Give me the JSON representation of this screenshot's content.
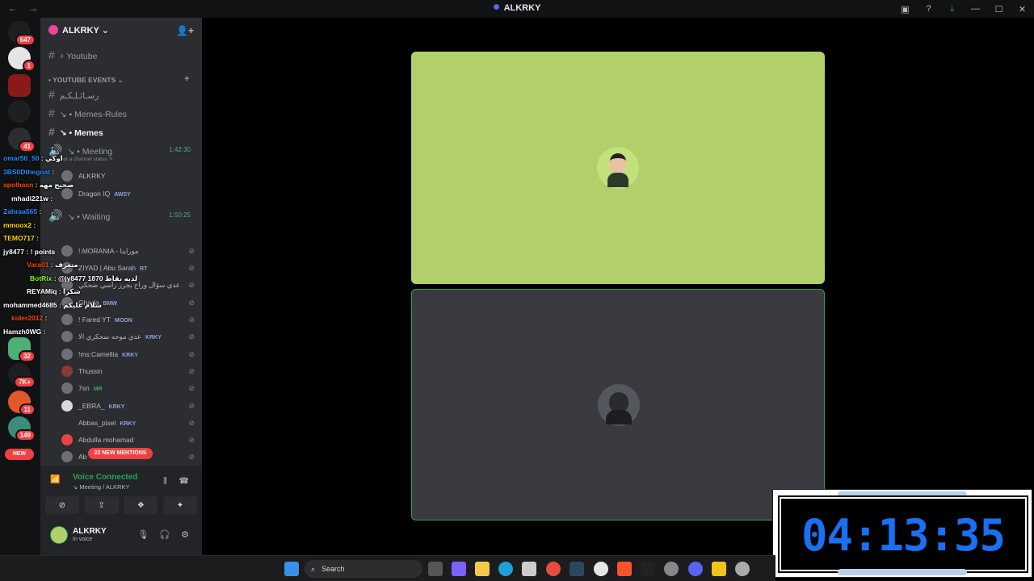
{
  "window": {
    "title": "ALKRKY",
    "nav_back": "←",
    "nav_forward": "→",
    "icons": [
      "screen-icon",
      "help-icon",
      "download-icon",
      "minimize-icon",
      "maximize-icon",
      "close-icon"
    ],
    "icon_glyphs": [
      "▣",
      "?",
      "⤓",
      "—",
      "☐",
      "✕"
    ]
  },
  "servers": {
    "badges": [
      "647",
      "1",
      "41",
      "32",
      "7K+",
      "11",
      "149"
    ],
    "new_label": "NEW"
  },
  "server_header": {
    "name": "ALKRKY",
    "chevron": "⌄",
    "invite_icon": "👤+"
  },
  "channels": [
    {
      "name": "፥ Youtube"
    },
    {
      "category": "• YOUTUBE EVENTS ⌄",
      "plus": "+"
    },
    {
      "name": "رسـائـلـكـم"
    },
    {
      "name": "↘ • Memes-Rules"
    },
    {
      "name": "↘ • Memes"
    },
    {
      "name": "↘ • Meeting",
      "time": "1:42:30",
      "sub": "Set a channel status ✎"
    }
  ],
  "meeting_users": [
    {
      "name": "ALKRKY",
      "tag": ""
    },
    {
      "name": "Dragon IQ",
      "tag": "AWSY"
    }
  ],
  "waiting_channel": {
    "name": "↘ • Waiting",
    "time": "1:50:25"
  },
  "waiting_users": [
    {
      "name": "!.MORANIA - موراينا",
      "tag": ""
    },
    {
      "name": "ZIYAD | Abu Sarah",
      "tag": "RT"
    },
    {
      "name": "عدي سؤال وراح يجرز رأسي ضحكي",
      "tag": ""
    },
    {
      "name": "Ghada",
      "tag": "BMW"
    },
    {
      "name": "! Fared YT",
      "tag": "MOON"
    },
    {
      "name": "عدي موجه تمجكري الا",
      "tag": "KRKY"
    },
    {
      "name": "!ms:Camellia",
      "tag": "KRKY"
    },
    {
      "name": "Thussin",
      "tag": ""
    },
    {
      "name": "7sn",
      "tag": "MR"
    },
    {
      "name": "_EBRA_",
      "tag": "KRKY"
    },
    {
      "name": "Abbas_pixel",
      "tag": "KRKY"
    },
    {
      "name": "Abdulla mohamad",
      "tag": ""
    },
    {
      "name": "Ab",
      "tag": ""
    }
  ],
  "chat": [
    {
      "user": "omar50_50",
      "msg": "اوكي",
      "color": "#1e90ff"
    },
    {
      "user": "3BS0Dthegoat",
      "msg": "",
      "color": "#1e90ff"
    },
    {
      "user": "apolhasn",
      "msg": "صحيح مهه",
      "color": "#ff4500"
    },
    {
      "user": "mhadi221w",
      "msg": "",
      "color": "#ffffff"
    },
    {
      "user": "Zahraa565",
      "msg": "",
      "color": "#1e90ff"
    },
    {
      "user": "mmoox2",
      "msg": "",
      "color": "#ffd700"
    },
    {
      "user": "TEMO717",
      "msg": "",
      "color": "#ffd700"
    },
    {
      "user": "jy8477",
      "msg": "! points",
      "color": "#ffffff"
    },
    {
      "user": "Vara01",
      "msg": "متعرف",
      "color": "#ff4500"
    },
    {
      "user": "BotRix",
      "msg": "@jy8477 لديه نقاط 1870",
      "color": "#7cfc00"
    },
    {
      "user": "REYAMiq",
      "msg": "شكرا",
      "color": "#ffffff"
    },
    {
      "user": "mohammed4685",
      "msg": "سلام عليكم",
      "color": "#ffffff"
    },
    {
      "user": "kider2012",
      "msg": "",
      "color": "#ff4500"
    },
    {
      "user": "Hamzh0WG",
      "msg": "",
      "color": "#ffffff"
    }
  ],
  "new_mentions": "22 NEW MENTIONS",
  "voice": {
    "status": "Voice Connected",
    "location": "↘ Meeting / ALKRKY",
    "buttons": [
      "cam-off",
      "screen-share",
      "activities",
      "soundboard"
    ],
    "button_glyphs": [
      "⊘",
      "⇪",
      "❖",
      "✦"
    ]
  },
  "user": {
    "name": "ALKRKY",
    "status": "In voice"
  },
  "timer": {
    "value": "04:13:35"
  },
  "taskbar": {
    "search_label": "Search",
    "search_icon": "⌕"
  }
}
